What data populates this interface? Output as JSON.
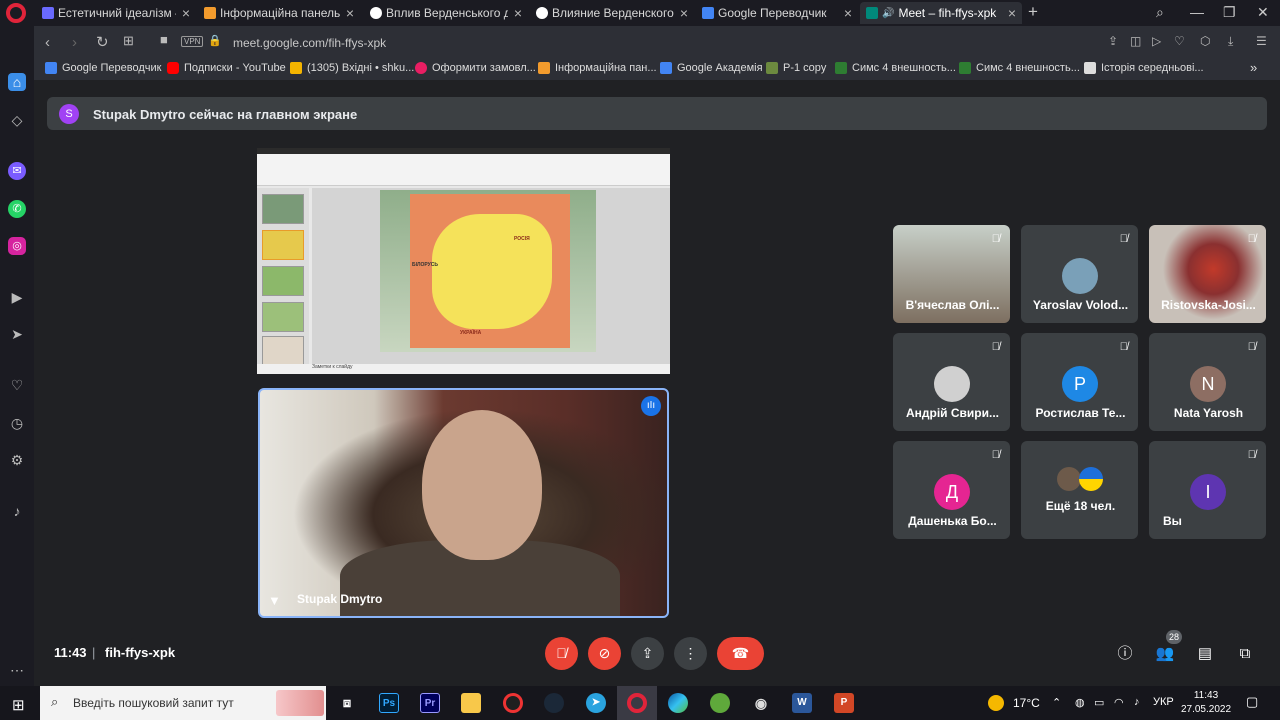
{
  "browser": {
    "tabs": [
      {
        "title": "Естетичний ідеалізм — ти",
        "favicon_color": "#6a6aff"
      },
      {
        "title": "Інформаційна панель",
        "favicon_color": "#f29b2d"
      },
      {
        "title": "Вплив Верденського дого",
        "favicon_color": "#ffffff"
      },
      {
        "title": "Влияние Верденского до",
        "favicon_color": "#ffffff"
      },
      {
        "title": "Google Переводчик",
        "favicon_color": "#4285f4"
      },
      {
        "title": "Meet – fih-ffys-xpk",
        "favicon_color": "#00897b"
      }
    ],
    "url": "meet.google.com/fih-ffys-xpk",
    "vpn_label": "VPN",
    "bookmarks": [
      {
        "label": "Google Переводчик",
        "color": "#4285f4"
      },
      {
        "label": "Подписки - YouTube",
        "color": "#ff0000"
      },
      {
        "label": "(1305) Вхідні • shku...",
        "color": "#f4b400"
      },
      {
        "label": "Оформити замовл...",
        "color": "#e91e63"
      },
      {
        "label": "Інформаційна пан...",
        "color": "#f29b2d"
      },
      {
        "label": "Google Академія",
        "color": "#4285f4"
      },
      {
        "label": "P-1 copy",
        "color": "#6c8a3f"
      },
      {
        "label": "Симс 4 внешность...",
        "color": "#2e7d32"
      },
      {
        "label": "Симс 4 внешность...",
        "color": "#2e7d32"
      },
      {
        "label": "Історія середньові...",
        "color": "#dddddd"
      }
    ]
  },
  "meet": {
    "banner": {
      "avatar_letter": "S",
      "text": "Stupak Dmytro сейчас на главном экране"
    },
    "presentation": {
      "slide_labels": [
        "БІЛОРУСЬ",
        "РОСІЯ",
        "УКРАЇНА"
      ],
      "status_text": "Заметки к слайду"
    },
    "speaker": {
      "name": "Stupak Dmytro"
    },
    "participants": [
      {
        "name": "В'ячеслав Олі...",
        "type": "video",
        "muted": true
      },
      {
        "name": "Yaroslav Volod...",
        "type": "photo",
        "muted": true
      },
      {
        "name": "Ristovska-Josi...",
        "type": "video",
        "muted": true
      },
      {
        "name": "Андрій Свири...",
        "type": "photo",
        "muted": true
      },
      {
        "name": "Ростислав Те...",
        "letter": "P",
        "color": "#1e88e5",
        "muted": true
      },
      {
        "name": "Nata Yarosh",
        "letter": "N",
        "color": "#8d6e63",
        "muted": true
      },
      {
        "name": "Дашенька Бо...",
        "letter": "Д",
        "color": "#e52592",
        "muted": true
      },
      {
        "name": "Ещё 18 чел.",
        "type": "more",
        "muted": false
      },
      {
        "name": "Вы",
        "letter": "I",
        "color": "#5e35b1",
        "muted": true
      }
    ],
    "time": "11:43",
    "meeting_code": "fih-ffys-xpk",
    "people_count": "28"
  },
  "taskbar": {
    "search_placeholder": "Введіть пошуковий запит тут",
    "weather": "17°C",
    "language": "УКР",
    "time": "11:43",
    "date": "27.05.2022"
  }
}
